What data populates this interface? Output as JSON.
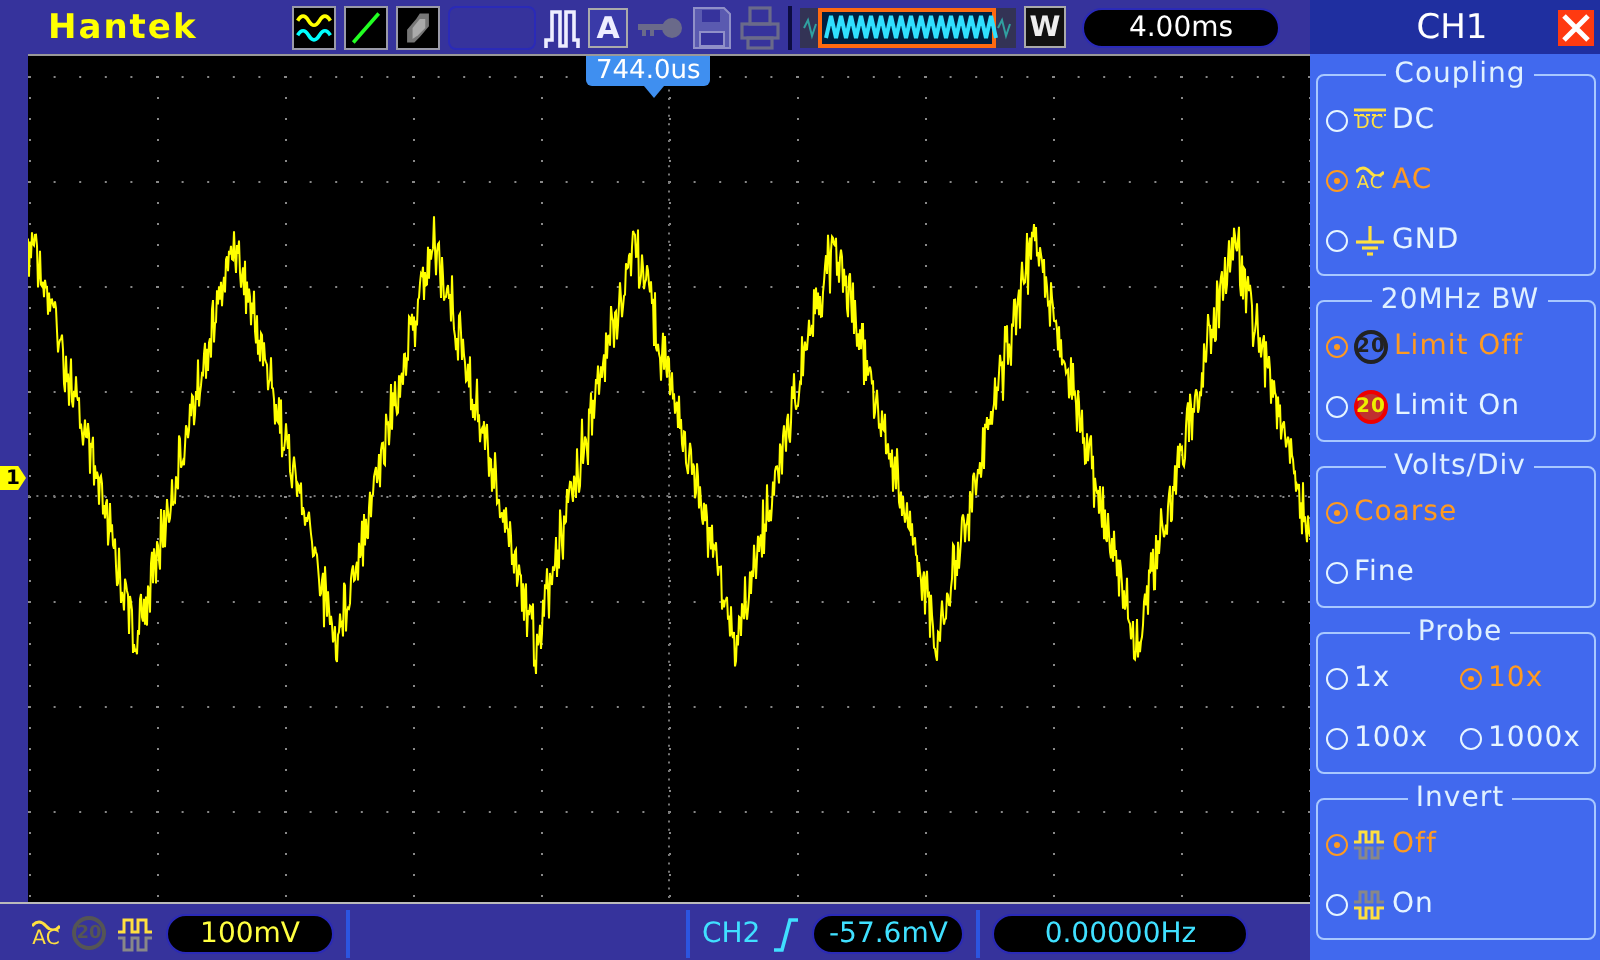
{
  "header": {
    "logo": "Hantek",
    "auto_button": "A",
    "mode_button": "W",
    "timebase": "4.00ms"
  },
  "plot": {
    "trigger_position": "744.0us",
    "channel_marker": "1"
  },
  "menu": {
    "title": "CH1",
    "sections": [
      {
        "title": "Coupling",
        "kind": "list",
        "options": [
          {
            "label": "DC",
            "kind": "dc",
            "icon_text": "DC",
            "selected": false
          },
          {
            "label": "AC",
            "kind": "ac",
            "icon_text": "AC",
            "selected": true
          },
          {
            "label": "GND",
            "kind": "gnd",
            "selected": false
          }
        ]
      },
      {
        "title": "20MHz BW",
        "kind": "list",
        "options": [
          {
            "label": "Limit Off",
            "kind": "bw_off",
            "icon_text": "20",
            "selected": true
          },
          {
            "label": "Limit On",
            "kind": "bw_on",
            "icon_text": "20",
            "selected": false
          }
        ]
      },
      {
        "title": "Volts/Div",
        "kind": "list",
        "options": [
          {
            "label": "Coarse",
            "kind": "plain",
            "selected": true
          },
          {
            "label": "Fine",
            "kind": "plain",
            "selected": false
          }
        ]
      },
      {
        "title": "Probe",
        "kind": "grid",
        "options": [
          {
            "label": "1x",
            "kind": "plain",
            "selected": false
          },
          {
            "label": "10x",
            "kind": "plain",
            "selected": true
          },
          {
            "label": "100x",
            "kind": "plain",
            "selected": false
          },
          {
            "label": "1000x",
            "kind": "plain",
            "selected": false
          }
        ]
      },
      {
        "title": "Invert",
        "kind": "list",
        "options": [
          {
            "label": "Off",
            "kind": "inv_off",
            "selected": true
          },
          {
            "label": "On",
            "kind": "inv_on",
            "selected": false
          }
        ]
      }
    ]
  },
  "status_bar": {
    "coupling_icon_text": "AC",
    "bw_icon_text": "20",
    "ch1_scale": "100mV",
    "trigger_source": "CH2",
    "trigger_level": "-57.6mV",
    "frequency": "0.00000Hz"
  }
}
